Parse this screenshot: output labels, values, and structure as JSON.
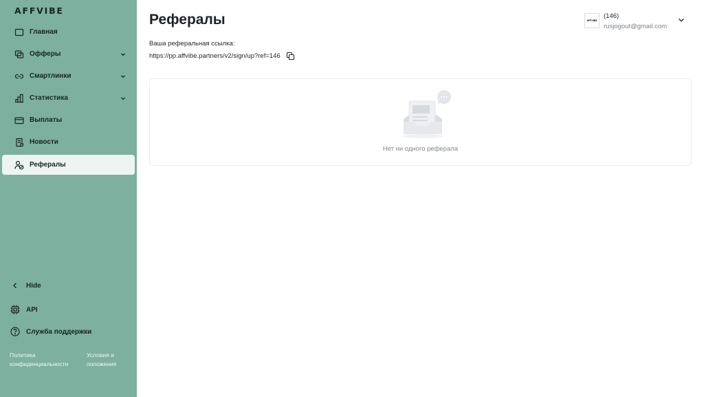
{
  "sidebar": {
    "logo": "AFFVIBE",
    "items": [
      {
        "label": "Главная",
        "icon": "home-icon",
        "has_chevron": false
      },
      {
        "label": "Офферы",
        "icon": "offers-icon",
        "has_chevron": true
      },
      {
        "label": "Смартлинки",
        "icon": "link-icon",
        "has_chevron": true
      },
      {
        "label": "Статистика",
        "icon": "chart-icon",
        "has_chevron": true
      },
      {
        "label": "Выплаты",
        "icon": "card-icon",
        "has_chevron": false
      },
      {
        "label": "Новости",
        "icon": "news-icon",
        "has_chevron": false
      },
      {
        "label": "Рефералы",
        "icon": "referrals-icon",
        "has_chevron": false,
        "active": true
      }
    ],
    "hide_label": "Hide",
    "api_label": "API",
    "support_label": "Служба поддержки",
    "privacy_label_line1": "Политика",
    "privacy_label_line2": "конфиденциальности",
    "terms_label_line1": "Условия и",
    "terms_label_line2": "положения"
  },
  "header": {
    "title": "Рефералы",
    "account_logo": "AFFVIBE",
    "account_id": "(146)",
    "account_email": "rusjogout@gmail.com"
  },
  "referral": {
    "label": "Ваша реферальная ссылка:",
    "link": "https://pp.affvibe.partners/v2/sign/up?ref=146"
  },
  "empty_state": {
    "message": "Нет ни одного реферала"
  },
  "colors": {
    "sidebar_bg": "#7db09f",
    "active_item_bg": "#eef4f1",
    "text_dark": "#16261f"
  }
}
